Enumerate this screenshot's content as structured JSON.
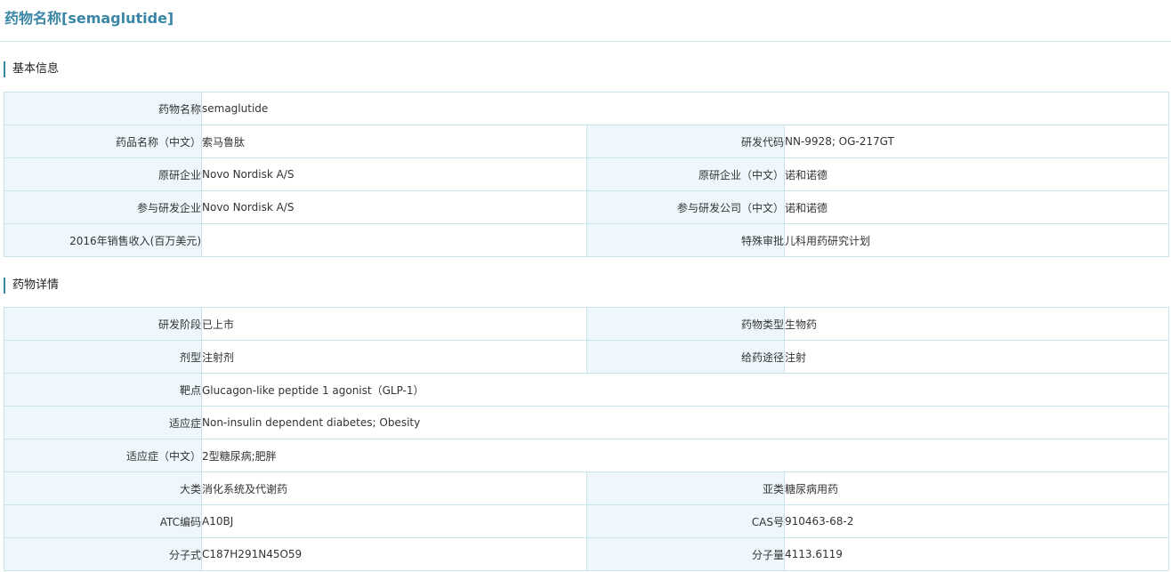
{
  "page": {
    "title": "药物名称[semaglutide]"
  },
  "basic": {
    "heading": "基本信息",
    "rows": [
      {
        "l1": "药物名称",
        "v1": "semaglutide"
      },
      {
        "l1": "药品名称（中文）",
        "v1": "索马鲁肽",
        "l2": "研发代码",
        "v2": "NN-9928; OG-217GT"
      },
      {
        "l1": "原研企业",
        "v1": "Novo Nordisk A/S",
        "l2": "原研企业（中文）",
        "v2": "诺和诺德"
      },
      {
        "l1": "参与研发企业",
        "v1": "Novo Nordisk A/S",
        "l2": "参与研发公司（中文）",
        "v2": "诺和诺德"
      },
      {
        "l1": "2016年销售收入(百万美元)",
        "v1": "",
        "l2": "特殊审批",
        "v2": "儿科用药研究计划"
      }
    ]
  },
  "detail": {
    "heading": "药物详情",
    "rows": [
      {
        "l1": "研发阶段",
        "v1": "已上市",
        "l2": "药物类型",
        "v2": "生物药"
      },
      {
        "l1": "剂型",
        "v1": "注射剂",
        "l2": "给药途径",
        "v2": "注射"
      },
      {
        "l1": "靶点",
        "v1": "Glucagon-like peptide 1 agonist（GLP-1）"
      },
      {
        "l1": "适应症",
        "v1": "Non-insulin dependent diabetes; Obesity"
      },
      {
        "l1": "适应症（中文）",
        "v1": "2型糖尿病;肥胖"
      },
      {
        "l1": "大类",
        "v1": "消化系统及代谢药",
        "l2": "亚类",
        "v2": "糖尿病用药"
      },
      {
        "l1": "ATC编码",
        "v1": "A10BJ",
        "l2": "CAS号",
        "v2": "910463-68-2"
      },
      {
        "l1": "分子式",
        "v1": "C187H291N45O59",
        "l2": "分子量",
        "v2": "4113.6119"
      }
    ]
  }
}
